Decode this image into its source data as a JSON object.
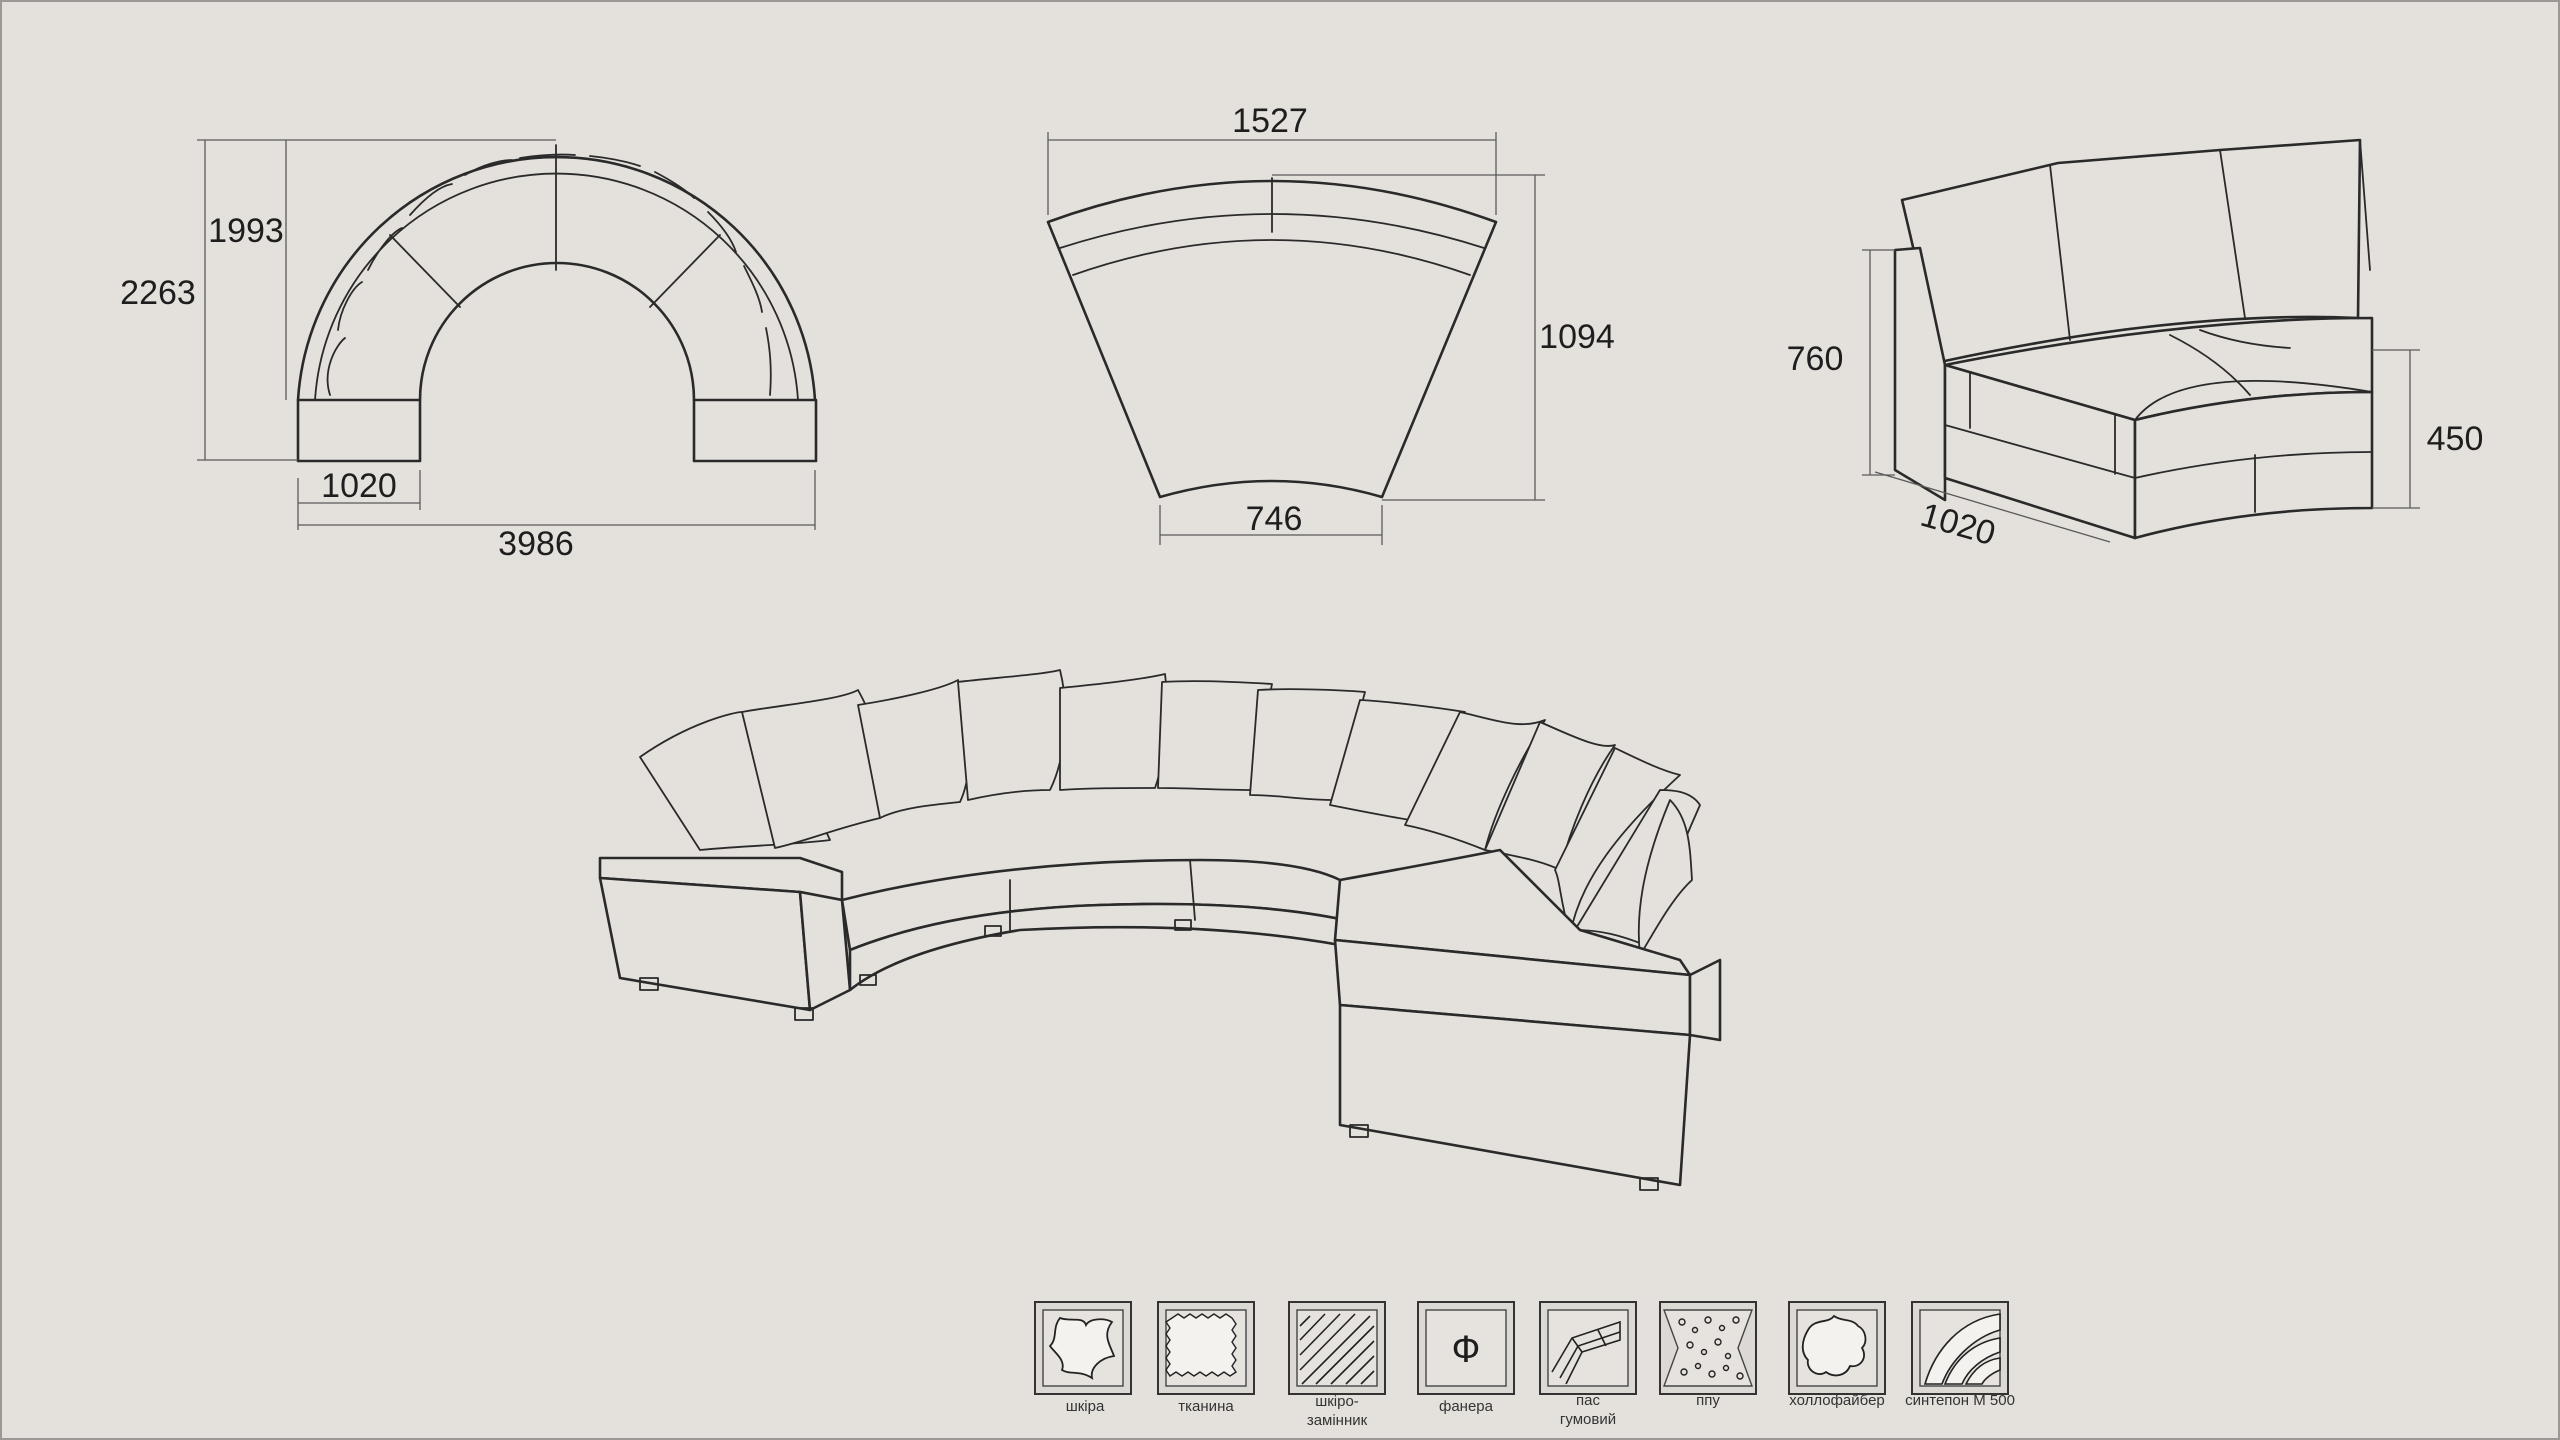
{
  "dimensions": {
    "plan_height_inner": "1993",
    "plan_height_total": "2263",
    "plan_module_width": "1020",
    "plan_total_width": "3986",
    "wedge_top_width": "1527",
    "wedge_depth": "1094",
    "wedge_bottom_width": "746",
    "module_height": "760",
    "module_seat_height": "450",
    "module_depth": "1020"
  },
  "materials": [
    {
      "icon": "leather-icon",
      "label": "шкіра",
      "label2": ""
    },
    {
      "icon": "fabric-icon",
      "label": "тканина",
      "label2": ""
    },
    {
      "icon": "faux-leather-icon",
      "label": "шкіро-",
      "label2": "замінник"
    },
    {
      "icon": "plywood-icon",
      "label": "фанера",
      "label2": "",
      "glyph": "Ф"
    },
    {
      "icon": "rubber-belt-icon",
      "label": "пас",
      "label2": "гумовий"
    },
    {
      "icon": "foam-icon",
      "label": "ппу",
      "label2": ""
    },
    {
      "icon": "hollofiber-icon",
      "label": "холлофайбер",
      "label2": ""
    },
    {
      "icon": "sintepon-icon",
      "label": "синтепон М 500",
      "label2": ""
    }
  ],
  "colors": {
    "background": "#e4e1dd",
    "line": "#2a2a2a"
  }
}
